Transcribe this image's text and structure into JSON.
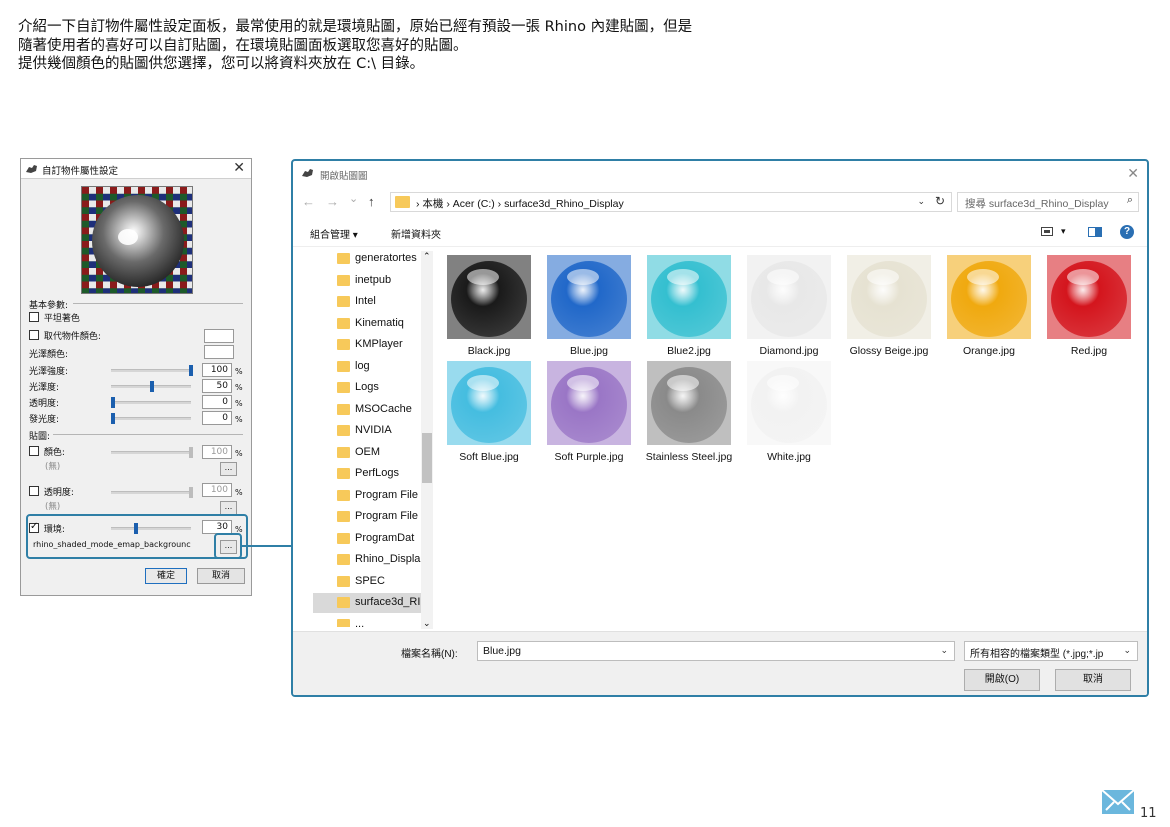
{
  "intro": {
    "line1": "介紹一下自訂物件屬性設定面板，最常使用的就是環境貼圖，原始已經有預設一張 Rhino 內建貼圖，但是",
    "line2": "隨著使用者的喜好可以自訂貼圖，在環境貼圖面板選取您喜好的貼圖。",
    "line3": "提供幾個顏色的貼圖供您選擇，您可以將資料夾放在 C:\\ 目錄。"
  },
  "panel": {
    "title": "自訂物件屬性設定",
    "close": "✕",
    "basic_section": "基本參數:",
    "flat_shading": "平坦著色",
    "override_color": "取代物件顏色:",
    "gloss_color": "光澤顏色:",
    "gloss_intensity": "光澤強度:",
    "gloss_intensity_value": "100",
    "glossiness": "光澤度:",
    "glossiness_value": "50",
    "transparency": "透明度:",
    "transparency_value": "0",
    "emission": "發光度:",
    "emission_value": "0",
    "percent": "%",
    "textures_section": "貼圖:",
    "color_tex": "顏色:",
    "color_tex_value": "100",
    "none1": "(無)",
    "ellipsis": "...",
    "transparency_tex": "透明度:",
    "transparency_tex_value": "100",
    "none2": "(無)",
    "environment": "環境:",
    "environment_value": "30",
    "emap_file": "rhino_shaded_mode_emap_backgrounc",
    "ok": "確定",
    "cancel": "取消",
    "sliders": {
      "gloss_intensity": 1.0,
      "glossiness": 0.5,
      "transparency": 0.0,
      "emission": 0.0,
      "color_tex": 1.0,
      "transparency_tex": 1.0,
      "environment": 0.3
    }
  },
  "dialog": {
    "title": "開啟貼圖圖",
    "close": "✕",
    "nav_back": "←",
    "nav_forward": "→",
    "nav_recent": "⌄",
    "nav_up": "↑",
    "breadcrumbs": "›  本機  ›  Acer (C:)  ›  surface3d_Rhino_Display",
    "search_placeholder": "搜尋 surface3d_Rhino_Display",
    "organize": "組合管理 ▾",
    "new_folder": "新增資料夾",
    "help": "?",
    "folders": [
      "generatortes",
      "inetpub",
      "Intel",
      "Kinematiq",
      "KMPlayer",
      "log",
      "Logs",
      "MSOCache",
      "NVIDIA",
      "OEM",
      "PerfLogs",
      "Program File",
      "Program File",
      "ProgramDat",
      "Rhino_Displa",
      "SPEC",
      "surface3d_RI",
      "..."
    ],
    "files": [
      {
        "name": "Black.jpg",
        "color": "#1a1a1a"
      },
      {
        "name": "Blue.jpg",
        "color": "#2168c9"
      },
      {
        "name": "Blue2.jpg",
        "color": "#34bfd0"
      },
      {
        "name": "Diamond.jpg",
        "color": "#e8e8e8"
      },
      {
        "name": "Glossy Beige.jpg",
        "color": "#e6e2d2"
      },
      {
        "name": "Orange.jpg",
        "color": "#f0a90f"
      },
      {
        "name": "Red.jpg",
        "color": "#d4151d"
      },
      {
        "name": "Soft Blue.jpg",
        "color": "#45bde0"
      },
      {
        "name": "Soft Purple.jpg",
        "color": "#9a76c6"
      },
      {
        "name": "Stainless Steel.jpg",
        "color": "#8a8a8a"
      },
      {
        "name": "White.jpg",
        "color": "#f2f2f2"
      }
    ],
    "filename_label": "檔案名稱(N):",
    "filename_value": "Blue.jpg",
    "filetype_value": "所有相容的檔案類型 (*.jpg;*.jp",
    "open": "開啟(O)",
    "cancel": "取消"
  },
  "page_number": "11",
  "accent_color": "#2f7fa6"
}
